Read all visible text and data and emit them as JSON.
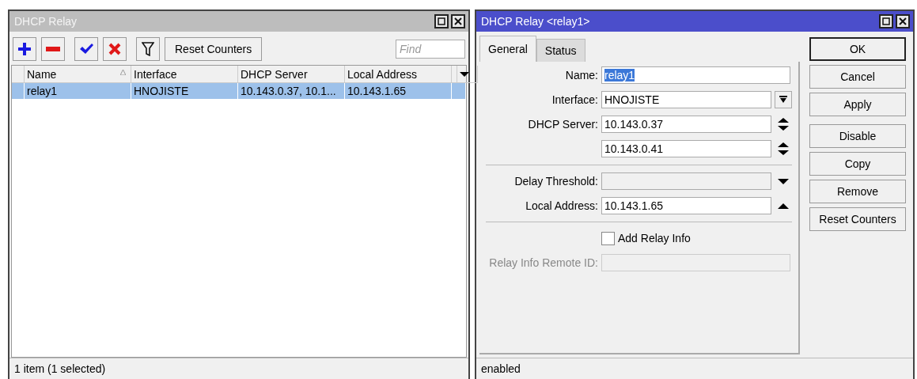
{
  "list_window": {
    "title": "DHCP Relay",
    "active": false,
    "toolbar": [
      {
        "kind": "add"
      },
      {
        "kind": "remove"
      },
      {
        "kind": "enable"
      },
      {
        "kind": "disable"
      },
      {
        "kind": "filter"
      },
      {
        "kind": "text",
        "label": "Reset Counters"
      }
    ],
    "find": {
      "placeholder": "Find"
    },
    "table": {
      "columns": [
        {
          "label": "Name",
          "sorted": true
        },
        {
          "label": "Interface",
          "sorted": false
        },
        {
          "label": "DHCP Server",
          "sorted": false
        },
        {
          "label": "Local Address",
          "sorted": false
        }
      ],
      "rows": [
        {
          "selected": true,
          "cells": [
            "relay1",
            "HNOJISTE",
            "10.143.0.37, 10.1...",
            "10.143.1.65"
          ]
        }
      ]
    },
    "status_bar": "1 item (1 selected)"
  },
  "edit_window": {
    "title": "DHCP Relay <relay1>",
    "active": true,
    "tabs": [
      {
        "label": "General",
        "selected": true
      },
      {
        "label": "Status",
        "selected": false
      }
    ],
    "form": [
      {
        "kind": "text",
        "label": "Name:",
        "value": "relay1",
        "value_selected": true,
        "disabled": false,
        "unset": false
      },
      {
        "kind": "combo",
        "label": "Interface:",
        "value": "HNOJISTE",
        "disabled": false,
        "unset": false
      },
      {
        "kind": "spinner",
        "label": "DHCP Server:",
        "value": "10.143.0.37",
        "disabled": false,
        "unset": false
      },
      {
        "kind": "spinner",
        "value": "10.143.0.41",
        "disabled": false,
        "unset": false
      },
      {
        "kind": "divider"
      },
      {
        "kind": "dropdown",
        "label": "Delay Threshold:",
        "disabled": false,
        "unset": true
      },
      {
        "kind": "dropup",
        "label": "Local Address:",
        "value": "10.143.1.65",
        "disabled": false,
        "unset": false
      },
      {
        "kind": "divider"
      },
      {
        "kind": "checkbox",
        "label": "Add Relay Info",
        "checked": false
      },
      {
        "kind": "text",
        "label": "Relay Info Remote ID:",
        "disabled": true,
        "unset": true
      }
    ],
    "buttons": [
      {
        "label": "OK",
        "default": true
      },
      {
        "label": "Cancel",
        "default": false
      },
      {
        "label": "Apply",
        "default": false
      },
      {
        "label": "Disable",
        "default": false
      },
      {
        "label": "Copy",
        "default": false
      },
      {
        "label": "Remove",
        "default": false
      },
      {
        "label": "Reset Counters",
        "default": false
      }
    ],
    "status_bar": "enabled"
  }
}
